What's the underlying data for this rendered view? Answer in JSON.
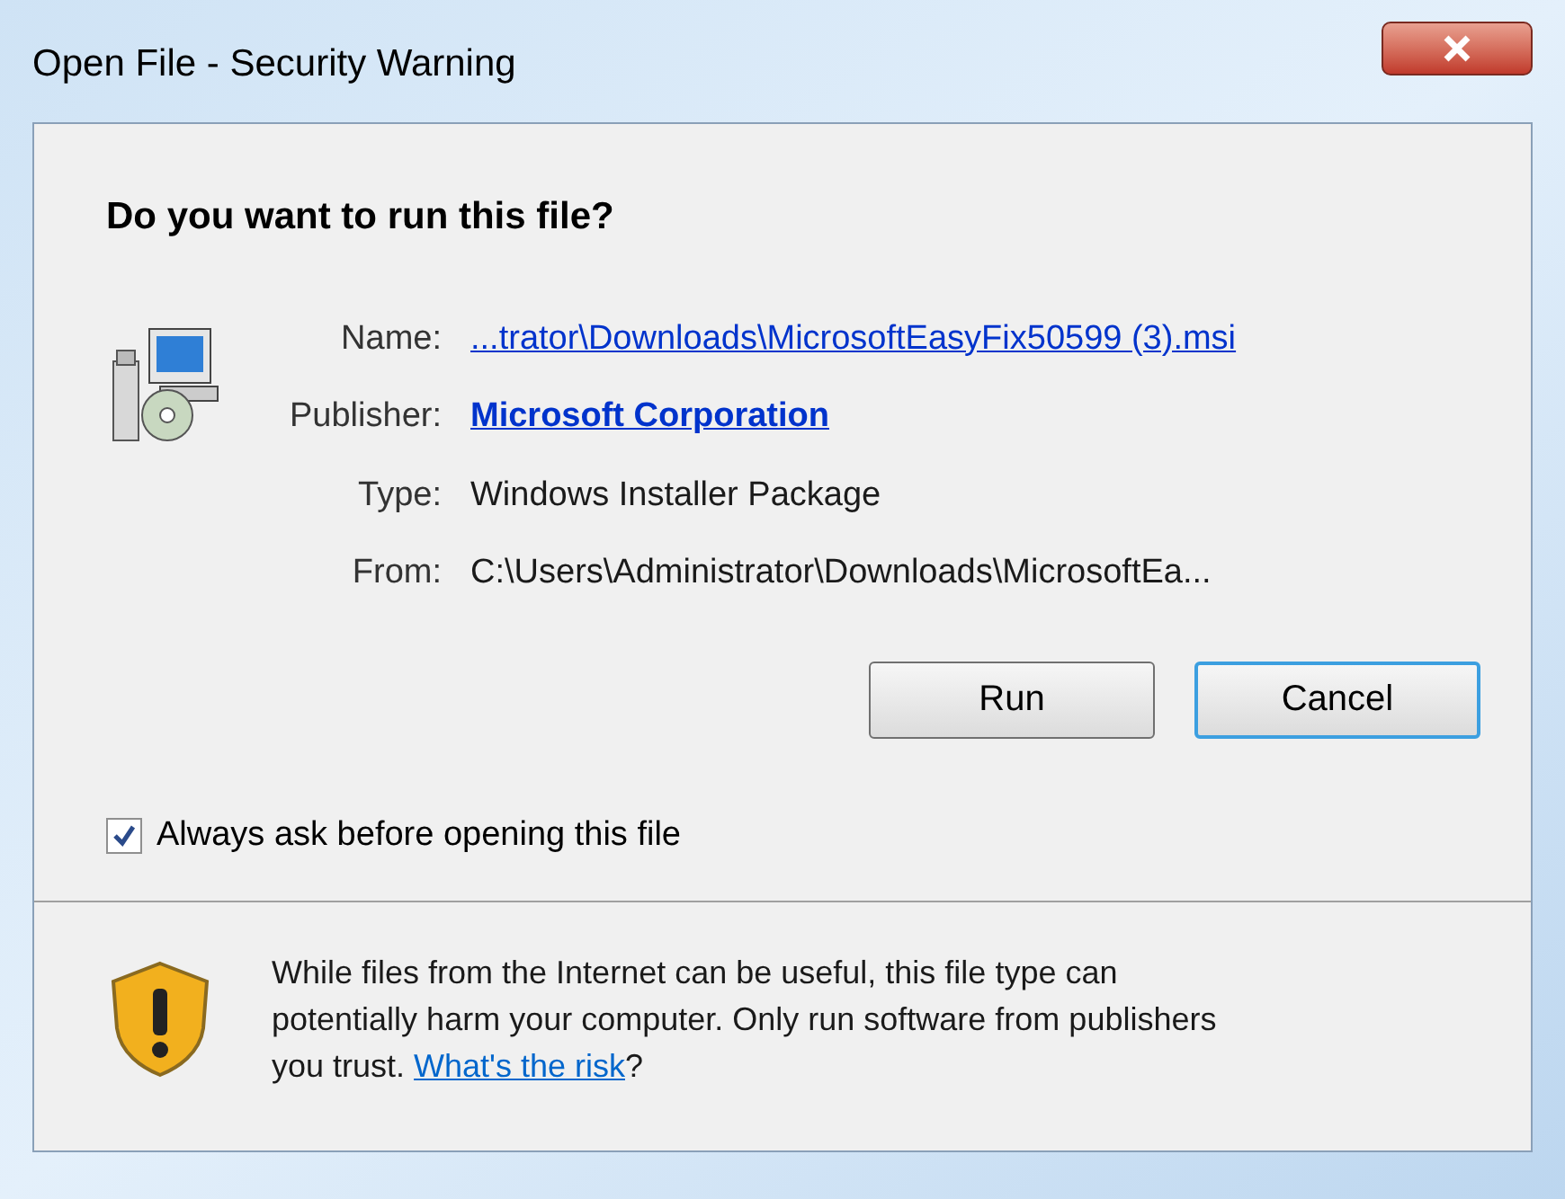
{
  "window": {
    "title": "Open File - Security Warning"
  },
  "heading": "Do you want to run this file?",
  "details": [
    {
      "label": "Name:",
      "value": "...trator\\Downloads\\MicrosoftEasyFix50599 (3).msi",
      "kind": "link"
    },
    {
      "label": "Publisher:",
      "value": "Microsoft Corporation",
      "kind": "bold-link"
    },
    {
      "label": "Type:",
      "value": "Windows Installer Package",
      "kind": "text"
    },
    {
      "label": "From:",
      "value": "C:\\Users\\Administrator\\Downloads\\MicrosoftEa...",
      "kind": "text"
    }
  ],
  "buttons": [
    {
      "label": "Run",
      "focused": false
    },
    {
      "label": "Cancel",
      "focused": true
    }
  ],
  "checkbox": {
    "label": "Always ask before opening this file",
    "checked": true
  },
  "warning": {
    "text": "While files from the Internet can be useful, this file type can potentially harm your computer. Only run software from publishers you trust. ",
    "link": "What's the risk",
    "after": "?"
  }
}
